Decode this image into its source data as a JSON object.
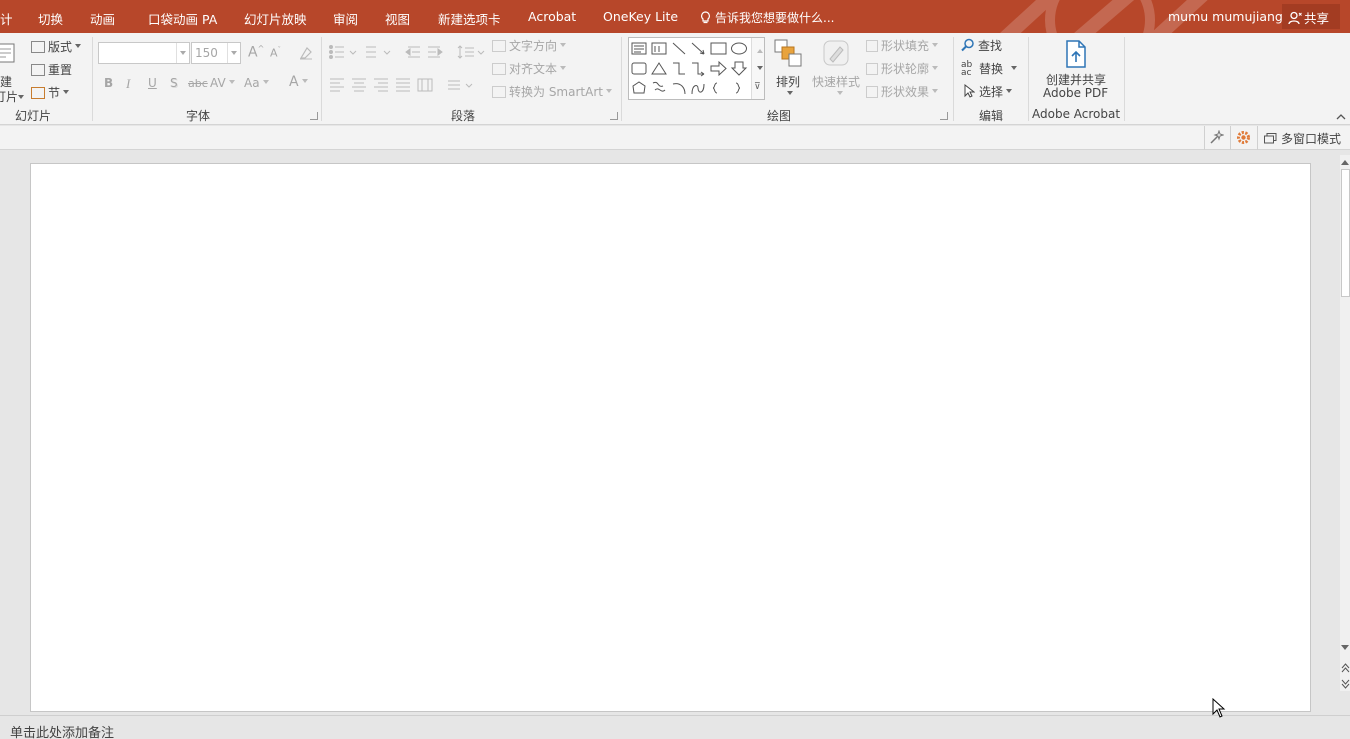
{
  "tabs": [
    {
      "label": "计"
    },
    {
      "label": "切换"
    },
    {
      "label": "动画"
    },
    {
      "label": "口袋动画 PA"
    },
    {
      "label": "幻灯片放映"
    },
    {
      "label": "审阅"
    },
    {
      "label": "视图"
    },
    {
      "label": "新建选项卡"
    },
    {
      "label": "Acrobat"
    },
    {
      "label": "OneKey Lite"
    }
  ],
  "tell_me": "告诉我您想要做什么...",
  "user_name": "mumu mumujiang",
  "share_label": "共享",
  "slides_group": {
    "new_slide_top": "建",
    "new_slide_bottom": "灯片",
    "layout": "版式",
    "reset": "重置",
    "section": "节",
    "label": "幻灯片"
  },
  "font_group": {
    "font_name": "",
    "font_size": "150",
    "bold": "B",
    "italic": "I",
    "underline": "U",
    "shadow": "S",
    "strike": "abc",
    "spacing": "AV",
    "case": "Aa",
    "color": "A",
    "grow": "A",
    "shrink": "A",
    "label": "字体"
  },
  "paragraph_group": {
    "text_direction": "文字方向",
    "align_text": "对齐文本",
    "convert_smartart": "转换为 SmartArt",
    "label": "段落"
  },
  "drawing_group": {
    "arrange": "排列",
    "quick_styles": "快速样式",
    "shape_fill": "形状填充",
    "shape_outline": "形状轮廓",
    "shape_effects": "形状效果",
    "label": "绘图"
  },
  "editing_group": {
    "find": "查找",
    "replace": "替换",
    "select": "选择",
    "label": "编辑"
  },
  "acrobat_group": {
    "create_line1": "创建并共享",
    "create_line2": "Adobe PDF",
    "label": "Adobe Acrobat"
  },
  "multi_window": "多窗口模式",
  "notes_placeholder": "单击此处添加备注",
  "colors": {
    "tab_bar": "#b7472a",
    "ribbon": "#f3f3f3",
    "accent_icon": "#2e75b6",
    "gear": "#e07b39"
  }
}
